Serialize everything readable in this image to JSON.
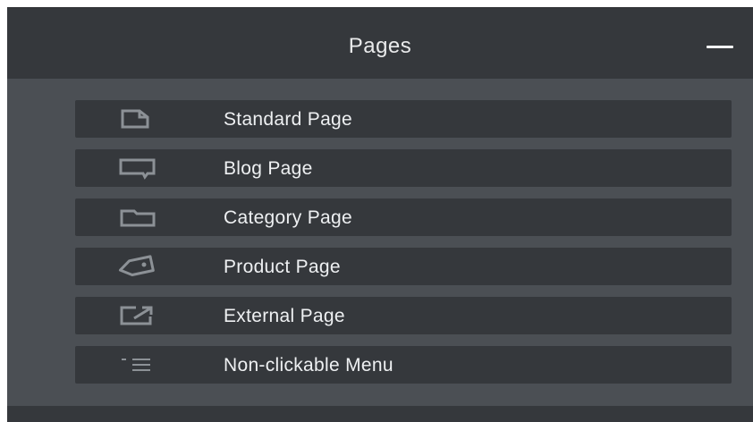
{
  "panel": {
    "title": "Pages",
    "collapse_icon": "minus-icon"
  },
  "menu": {
    "items": [
      {
        "label": "Standard Page",
        "icon": "page-icon"
      },
      {
        "label": "Blog Page",
        "icon": "speech-bubble-icon"
      },
      {
        "label": "Category Page",
        "icon": "folder-icon"
      },
      {
        "label": "Product Page",
        "icon": "tag-icon"
      },
      {
        "label": "External Page",
        "icon": "external-link-icon"
      },
      {
        "label": "Non-clickable Menu",
        "icon": "menu-lines-icon"
      }
    ]
  },
  "colors": {
    "panel_background": "#4b4f54",
    "header_background": "#35383c",
    "item_background": "#35383c",
    "text": "#eef0f2",
    "icon": "#8c9196"
  }
}
